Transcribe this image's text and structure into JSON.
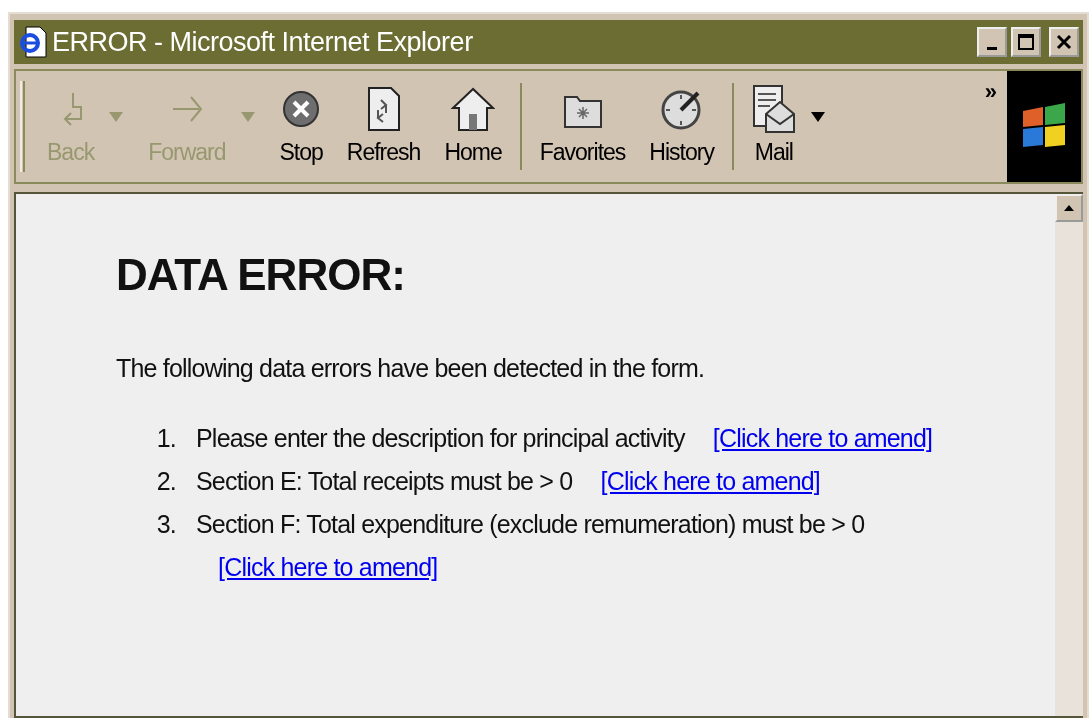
{
  "window": {
    "title": "ERROR - Microsoft Internet Explorer"
  },
  "toolbar": {
    "groups": [
      [
        {
          "label": "Back",
          "kind": "back",
          "disabled": true,
          "dropdown": true
        },
        {
          "label": "Forward",
          "kind": "forward",
          "disabled": true,
          "dropdown": true
        },
        {
          "label": "Stop",
          "kind": "stop",
          "disabled": false,
          "dropdown": false
        },
        {
          "label": "Refresh",
          "kind": "refresh",
          "disabled": false,
          "dropdown": false
        },
        {
          "label": "Home",
          "kind": "home",
          "disabled": false,
          "dropdown": false
        }
      ],
      [
        {
          "label": "Favorites",
          "kind": "favorites",
          "disabled": false,
          "dropdown": false
        },
        {
          "label": "History",
          "kind": "history",
          "disabled": false,
          "dropdown": false
        }
      ],
      [
        {
          "label": "Mail",
          "kind": "mail",
          "disabled": false,
          "dropdown": true
        }
      ]
    ],
    "more": "»"
  },
  "page": {
    "heading": "DATA ERROR:",
    "intro": "The following data errors have been detected in the form.",
    "errors": [
      {
        "number": "1.",
        "text": "Please enter the description for principal activity",
        "link": "[Click here to amend]"
      },
      {
        "number": "2.",
        "text": "Section E: Total receipts must be > 0",
        "link": "[Click here to amend]"
      },
      {
        "number": "3.",
        "text": "Section F: Total expenditure (exclude remumeration) must be > 0",
        "link": "[Click here to amend]"
      }
    ]
  }
}
